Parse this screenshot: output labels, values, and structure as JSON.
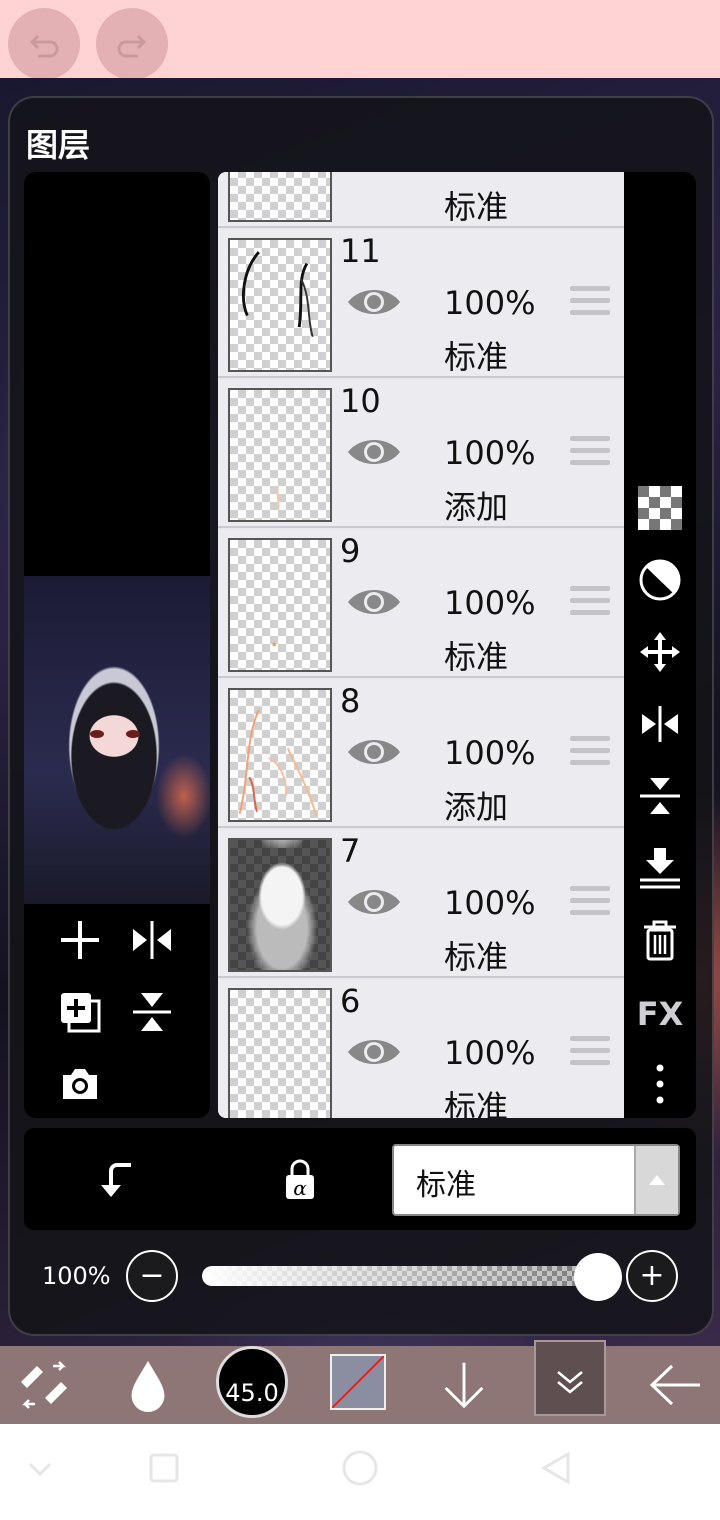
{
  "panel": {
    "title": "图层"
  },
  "layers": [
    {
      "number": "",
      "opacity": "",
      "blend": "标准",
      "partial": true
    },
    {
      "number": "11",
      "opacity": "100%",
      "blend": "标准"
    },
    {
      "number": "10",
      "opacity": "100%",
      "blend": "添加"
    },
    {
      "number": "9",
      "opacity": "100%",
      "blend": "标准"
    },
    {
      "number": "8",
      "opacity": "100%",
      "blend": "添加"
    },
    {
      "number": "7",
      "opacity": "100%",
      "blend": "标准"
    },
    {
      "number": "6",
      "opacity": "100%",
      "blend": "标准"
    }
  ],
  "blend_select": {
    "value": "标准"
  },
  "opacity_slider": {
    "label": "100%",
    "value": 1.0
  },
  "brush": {
    "size": "45.0"
  },
  "right_tools": {
    "fx_label": "FX"
  },
  "icons": {
    "undo": "undo-icon",
    "redo": "redo-icon",
    "add_layer": "plus-icon",
    "flip_h": "flip-horizontal-icon",
    "duplicate": "duplicate-layer-icon",
    "flip_v": "flip-vertical-icon",
    "camera": "camera-icon",
    "transparency": "checkerboard-icon",
    "invert": "half-circle-icon",
    "move": "move-icon",
    "merge_down": "merge-down-icon",
    "delete": "trash-icon",
    "more": "more-vertical-icon",
    "clip": "clipping-arrow-icon",
    "alpha_lock": "alpha-lock-icon",
    "eraser_swap": "swap-tool-icon",
    "blur": "drop-icon",
    "arrow_down": "arrow-down-icon",
    "collapse": "chevron-double-down-icon",
    "back": "arrow-left-icon"
  }
}
